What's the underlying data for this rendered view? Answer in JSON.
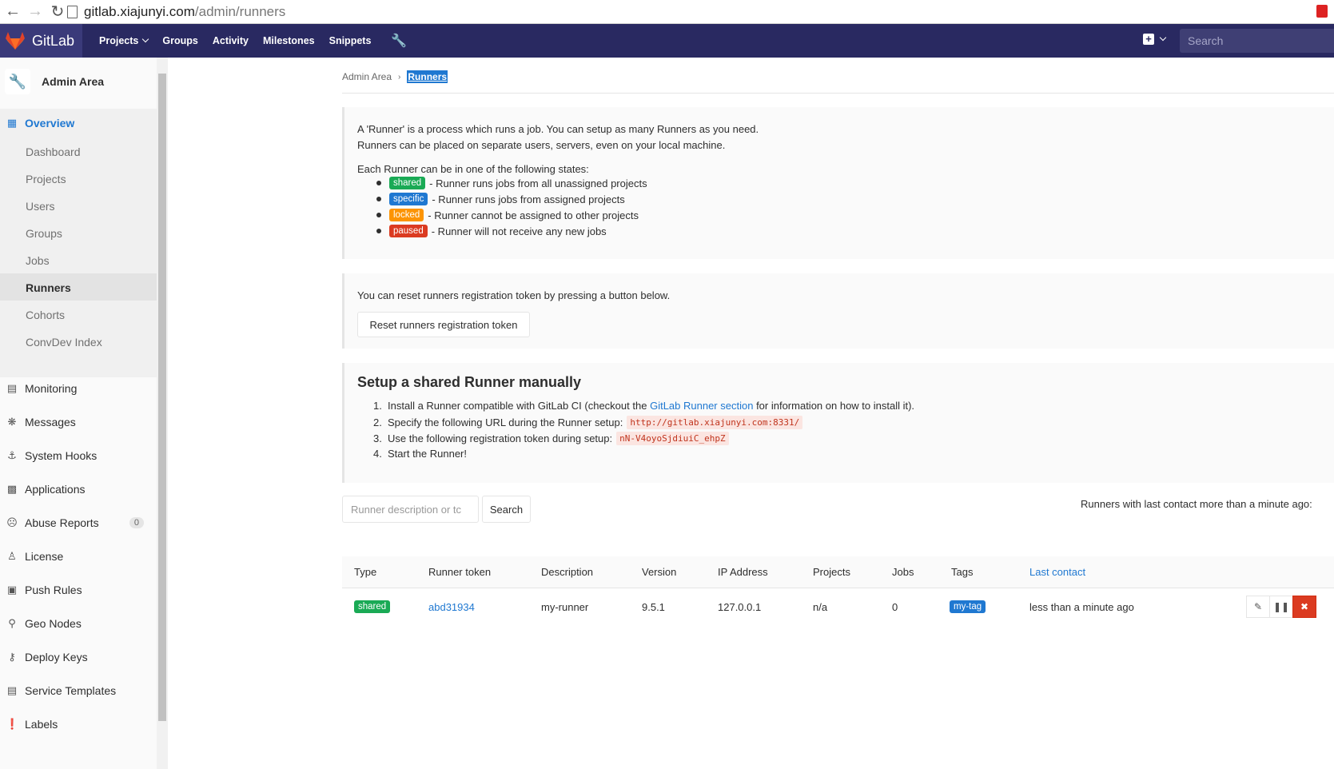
{
  "browser": {
    "url_host": "gitlab.xiajunyi.com",
    "url_path": "/admin/runners"
  },
  "header": {
    "logo_text": "GitLab",
    "nav": [
      "Projects",
      "Groups",
      "Activity",
      "Milestones",
      "Snippets"
    ],
    "search_placeholder": "Search"
  },
  "sidebar": {
    "title": "Admin Area",
    "overview": "Overview",
    "sub_items": [
      "Dashboard",
      "Projects",
      "Users",
      "Groups",
      "Jobs",
      "Runners",
      "Cohorts",
      "ConvDev Index"
    ],
    "active_sub": "Runners",
    "sections": [
      "Monitoring",
      "Messages",
      "System Hooks",
      "Applications",
      "Abuse Reports",
      "License",
      "Push Rules",
      "Geo Nodes",
      "Deploy Keys",
      "Service Templates",
      "Labels"
    ],
    "abuse_count": "0"
  },
  "breadcrumb": {
    "parent": "Admin Area",
    "current": "Runners"
  },
  "info": {
    "line1": "A 'Runner' is a process which runs a job. You can setup as many Runners as you need.",
    "line2": "Runners can be placed on separate users, servers, even on your local machine.",
    "states_intro": "Each Runner can be in one of the following states:",
    "states": [
      {
        "label": "shared",
        "text": "- Runner runs jobs from all unassigned projects",
        "color": "#1aaa55"
      },
      {
        "label": "specific",
        "text": "- Runner runs jobs from assigned projects",
        "color": "#1f78d1"
      },
      {
        "label": "locked",
        "text": "- Runner cannot be assigned to other projects",
        "color": "#fc9403"
      },
      {
        "label": "paused",
        "text": "- Runner will not receive any new jobs",
        "color": "#db3b21"
      }
    ]
  },
  "reset": {
    "text": "You can reset runners registration token by pressing a button below.",
    "button": "Reset runners registration token"
  },
  "setup": {
    "title": "Setup a shared Runner manually",
    "step1_pre": "Install a Runner compatible with GitLab CI (checkout the",
    "step1_link": "GitLab Runner section",
    "step1_post": "for information on how to install it).",
    "step2": "Specify the following URL during the Runner setup:",
    "url": "http://gitlab.xiajunyi.com:8331/",
    "step3": "Use the following registration token during setup:",
    "token": "nN-V4oyoSjdiuiC_ehpZ",
    "step4": "Start the Runner!"
  },
  "filter": {
    "placeholder": "Runner description or tc",
    "search_button": "Search",
    "contact_note": "Runners with last contact more than a minute ago:"
  },
  "table": {
    "headers": {
      "type": "Type",
      "token": "Runner token",
      "description": "Description",
      "version": "Version",
      "ip": "IP Address",
      "projects": "Projects",
      "jobs": "Jobs",
      "tags": "Tags",
      "last_contact": "Last contact"
    },
    "row": {
      "type": "shared",
      "token": "abd31934",
      "description": "my-runner",
      "version": "9.5.1",
      "ip": "127.0.0.1",
      "projects": "n/a",
      "jobs": "0",
      "tag": "my-tag",
      "last_contact": "less than a minute ago"
    }
  },
  "colors": {
    "header_bg": "#292961",
    "link": "#1f78d1",
    "success": "#1aaa55",
    "danger": "#db3b21"
  }
}
